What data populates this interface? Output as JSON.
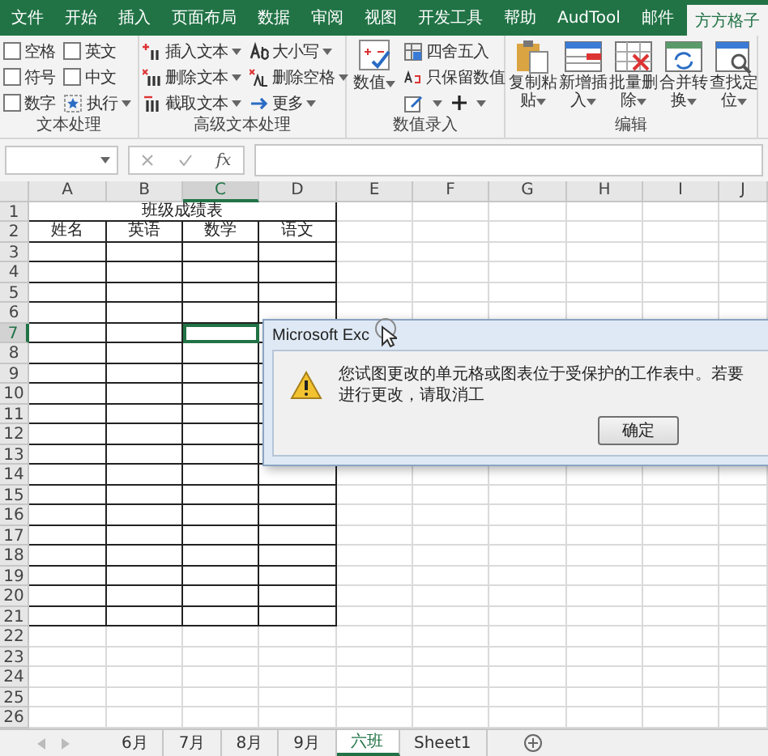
{
  "ribbon_tabs": [
    {
      "label": "文件",
      "selected": false
    },
    {
      "label": "开始",
      "selected": false
    },
    {
      "label": "插入",
      "selected": false
    },
    {
      "label": "页面布局",
      "selected": false
    },
    {
      "label": "数据",
      "selected": false
    },
    {
      "label": "审阅",
      "selected": false
    },
    {
      "label": "视图",
      "selected": false
    },
    {
      "label": "开发工具",
      "selected": false
    },
    {
      "label": "帮助",
      "selected": false
    },
    {
      "label": "AudTool",
      "selected": false
    },
    {
      "label": "邮件",
      "selected": false
    },
    {
      "label": "方方格子",
      "selected": true
    }
  ],
  "ribbon_groups": [
    {
      "title": "文本处理",
      "columns": [
        [
          {
            "kind": "check",
            "label": "空格",
            "checked": false
          },
          {
            "kind": "check",
            "label": "符号",
            "checked": false
          },
          {
            "kind": "check",
            "label": "数字",
            "checked": false
          }
        ],
        [
          {
            "kind": "check",
            "label": "英文",
            "checked": false
          },
          {
            "kind": "check",
            "label": "中文",
            "checked": false
          },
          {
            "kind": "small",
            "label": "执行",
            "dropdown": true
          }
        ]
      ]
    },
    {
      "title": "高级文本处理",
      "columns": [
        [
          {
            "kind": "small",
            "label": "插入文本",
            "dropdown": true
          },
          {
            "kind": "small",
            "label": "删除文本",
            "dropdown": true
          },
          {
            "kind": "small",
            "label": "截取文本",
            "dropdown": true
          }
        ],
        [
          {
            "kind": "small",
            "label": "大小写",
            "dropdown": true
          },
          {
            "kind": "small",
            "label": "删除空格",
            "dropdown": true
          },
          {
            "kind": "small",
            "label": "更多",
            "dropdown": true
          }
        ]
      ]
    },
    {
      "title": "数值录入",
      "columns": [
        [
          {
            "kind": "large",
            "label": "数值",
            "dropdown": true
          }
        ],
        [
          {
            "kind": "small",
            "label": "四舍五入",
            "dropdown": false
          },
          {
            "kind": "small",
            "label": "只保留数值",
            "dropdown": false
          },
          {
            "kind": "icons"
          }
        ]
      ]
    },
    {
      "title": "编辑",
      "columns": [
        [
          {
            "kind": "large",
            "label": "复制粘贴",
            "dropdown": true
          }
        ],
        [
          {
            "kind": "large",
            "label": "新增插入",
            "dropdown": true
          }
        ],
        [
          {
            "kind": "large",
            "label": "批量删除",
            "dropdown": true
          }
        ],
        [
          {
            "kind": "large",
            "label": "合并转换",
            "dropdown": true
          }
        ],
        [
          {
            "kind": "large",
            "label": "查找定位",
            "dropdown": true
          }
        ]
      ]
    }
  ],
  "formula_bar": {
    "function_label": "fx"
  },
  "grid": {
    "columns": [
      {
        "label": "A",
        "selected": false
      },
      {
        "label": "B",
        "selected": false
      },
      {
        "label": "C",
        "selected": true
      },
      {
        "label": "D",
        "selected": false
      },
      {
        "label": "E",
        "selected": false
      },
      {
        "label": "F",
        "selected": false
      },
      {
        "label": "G",
        "selected": false
      },
      {
        "label": "H",
        "selected": false
      },
      {
        "label": "I",
        "selected": false
      },
      {
        "label": "J",
        "selected": false
      }
    ],
    "rows": [
      {
        "label": "1",
        "selected": false,
        "bordered": true,
        "title": "班级成绩表"
      },
      {
        "label": "2",
        "selected": false,
        "bordered": true,
        "cells": [
          "姓名",
          "英语",
          "数学",
          "语文"
        ]
      },
      {
        "label": "3",
        "selected": false,
        "bordered": true
      },
      {
        "label": "4",
        "selected": false,
        "bordered": true
      },
      {
        "label": "5",
        "selected": false,
        "bordered": true
      },
      {
        "label": "6",
        "selected": false,
        "bordered": true
      },
      {
        "label": "7",
        "selected": true,
        "bordered": true
      },
      {
        "label": "8",
        "selected": false,
        "bordered": true
      },
      {
        "label": "9",
        "selected": false,
        "bordered": true
      },
      {
        "label": "10",
        "selected": false,
        "bordered": true
      },
      {
        "label": "11",
        "selected": false,
        "bordered": true
      },
      {
        "label": "12",
        "selected": false,
        "bordered": true
      },
      {
        "label": "13",
        "selected": false,
        "bordered": true
      },
      {
        "label": "14",
        "selected": false,
        "bordered": true
      },
      {
        "label": "15",
        "selected": false,
        "bordered": true
      },
      {
        "label": "16",
        "selected": false,
        "bordered": true
      },
      {
        "label": "17",
        "selected": false,
        "bordered": true
      },
      {
        "label": "18",
        "selected": false,
        "bordered": true
      },
      {
        "label": "19",
        "selected": false,
        "bordered": true
      },
      {
        "label": "20",
        "selected": false,
        "bordered": true
      },
      {
        "label": "21",
        "selected": false,
        "bordered": true
      },
      {
        "label": "22",
        "selected": false,
        "bordered": false
      },
      {
        "label": "23",
        "selected": false,
        "bordered": false
      },
      {
        "label": "24",
        "selected": false,
        "bordered": false
      },
      {
        "label": "25",
        "selected": false,
        "bordered": false
      },
      {
        "label": "26",
        "selected": false,
        "bordered": false
      }
    ]
  },
  "dialog": {
    "title": "Microsoft Exc",
    "message": "您试图更改的单元格或图表位于受保护的工作表中。若要进行更改，请取消工",
    "button": "确定"
  },
  "sheet_tabs": [
    {
      "label": "6月",
      "selected": false
    },
    {
      "label": "7月",
      "selected": false
    },
    {
      "label": "8月",
      "selected": false
    },
    {
      "label": "9月",
      "selected": false
    },
    {
      "label": "六班",
      "selected": true
    },
    {
      "label": "Sheet1",
      "selected": false
    }
  ]
}
